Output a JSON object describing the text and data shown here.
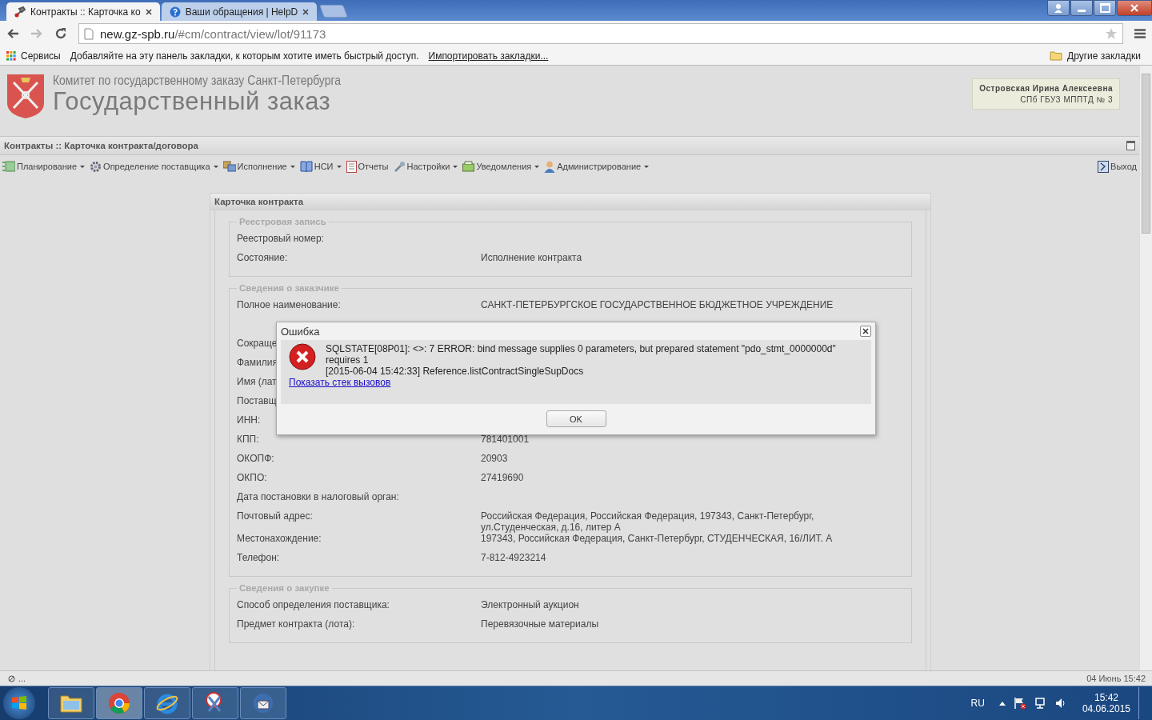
{
  "browser": {
    "tabs": [
      {
        "title": "Контракты :: Карточка ко",
        "selected": true
      },
      {
        "title": "Ваши обращения | HelpD",
        "selected": false
      }
    ],
    "url_host": "new.gz-spb.ru",
    "url_path": "/#cm/contract/view/lot/91173",
    "bookmarks": {
      "apps": "Сервисы",
      "hint": "Добавляйте на эту панель закладки, к которым хотите иметь быстрый доступ.",
      "import_link": "Импортировать закладки...",
      "other": "Другие закладки"
    }
  },
  "header": {
    "org": "Комитет по государственному заказу Санкт-Петербурга",
    "title": "Государственный заказ",
    "user_name": "Островская Ирина Алексеевна",
    "user_org": "СПб ГБУЗ МППТД № 3"
  },
  "breadcrumb": "Контракты :: Карточка контракта/договора",
  "menu": [
    {
      "label": "Планирование",
      "kind": "plan",
      "has_menu": true
    },
    {
      "label": "Определение поставщика",
      "kind": "gear",
      "has_menu": true
    },
    {
      "label": "Исполнение",
      "kind": "exec",
      "has_menu": true
    },
    {
      "label": "НСИ",
      "kind": "book",
      "has_menu": true
    },
    {
      "label": "Отчеты",
      "kind": "report",
      "has_menu": false
    },
    {
      "label": "Настройки",
      "kind": "wrench",
      "has_menu": true
    },
    {
      "label": "Уведомления",
      "kind": "tray",
      "has_menu": true
    },
    {
      "label": "Администрирование",
      "kind": "user",
      "has_menu": true
    }
  ],
  "exit": "Выход",
  "card": {
    "title": "Карточка контракта",
    "sections": [
      {
        "legend": "Реестровая запись",
        "rows": [
          {
            "label": "Реестровый номер:"
          },
          {
            "label": "Состояние:",
            "value": "Исполнение контракта"
          }
        ]
      },
      {
        "legend": "Сведения о заказчике",
        "rows": [
          {
            "label": "Полное наименование:",
            "value": "САНКТ-ПЕТЕРБУРГСКОЕ ГОСУДАРСТВЕННОЕ БЮДЖЕТНОЕ УЧРЕЖДЕНИЕ",
            "kind": "tall"
          },
          {
            "label": "Сокраще"
          },
          {
            "label": "Фамилия"
          },
          {
            "label": "Имя (лат"
          },
          {
            "label": "Поставщ"
          },
          {
            "label": "ИНН:"
          },
          {
            "label": "КПП:",
            "value": "781401001"
          },
          {
            "label": "ОКОПФ:",
            "value": "20903"
          },
          {
            "label": "ОКПО:",
            "value": "27419690"
          },
          {
            "label": "Дата постановки в налоговый орган:"
          },
          {
            "label": "Почтовый адрес:",
            "value": "Российская Федерация, Российская Федерация, 197343, Санкт-Петербург, ул.Студенческая, д.16, литер А"
          },
          {
            "label": "Местонахождение:",
            "value": "197343, Российская Федерация, Санкт-Петербург, СТУДЕНЧЕСКАЯ, 16/ЛИТ. А"
          },
          {
            "label": "Телефон:",
            "value": "7-812-4923214"
          }
        ]
      },
      {
        "legend": "Сведения о закупке",
        "rows": [
          {
            "label": "Способ определения поставщика:",
            "value": "Электронный аукцион"
          },
          {
            "label": "Предмет контракта (лота):",
            "value": "Перевязочные материалы"
          }
        ]
      }
    ]
  },
  "dialog": {
    "title": "Ошибка",
    "message": "SQLSTATE[08P01]: <>: 7 ERROR: bind message supplies 0 parameters, but prepared statement \"pdo_stmt_0000000d\" requires 1",
    "detail": "[2015-06-04 15:42:33] Reference.listContractSingleSupDocs",
    "link": "Показать стек вызовов",
    "button": "OK"
  },
  "status_bar": {
    "left": "...",
    "right": "04 Июнь 15:42"
  },
  "taskbar": {
    "apps": [
      {
        "kind": "folder",
        "selected": false
      },
      {
        "kind": "chrome",
        "selected": true
      },
      {
        "kind": "ie",
        "selected": false
      },
      {
        "kind": "scissors",
        "selected": false
      },
      {
        "kind": "mail",
        "selected": false
      }
    ],
    "language": "RU",
    "time": "15:42",
    "date": "04.06.2015"
  }
}
